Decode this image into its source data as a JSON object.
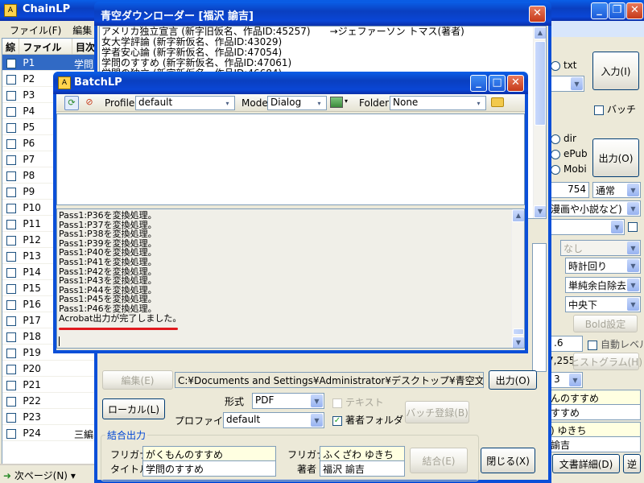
{
  "chainlp": {
    "title": "ChainLP",
    "menu": [
      "ファイル(F)",
      "編集(E)"
    ],
    "list_headers": [
      "綜",
      "ファイル",
      "目次"
    ],
    "rows": [
      {
        "label": "P1",
        "toc": "学問"
      },
      {
        "label": "P2",
        "toc": ""
      },
      {
        "label": "P3",
        "toc": ""
      },
      {
        "label": "P4",
        "toc": ""
      },
      {
        "label": "P5",
        "toc": ""
      },
      {
        "label": "P6",
        "toc": ""
      },
      {
        "label": "P7",
        "toc": ""
      },
      {
        "label": "P8",
        "toc": ""
      },
      {
        "label": "P9",
        "toc": ""
      },
      {
        "label": "P10",
        "toc": ""
      },
      {
        "label": "P11",
        "toc": ""
      },
      {
        "label": "P12",
        "toc": ""
      },
      {
        "label": "P13",
        "toc": ""
      },
      {
        "label": "P14",
        "toc": ""
      },
      {
        "label": "P15",
        "toc": ""
      },
      {
        "label": "P16",
        "toc": ""
      },
      {
        "label": "P17",
        "toc": ""
      },
      {
        "label": "P18",
        "toc": ""
      },
      {
        "label": "P19",
        "toc": ""
      },
      {
        "label": "P20",
        "toc": ""
      },
      {
        "label": "P21",
        "toc": ""
      },
      {
        "label": "P22",
        "toc": ""
      },
      {
        "label": "P23",
        "toc": ""
      },
      {
        "label": "P24",
        "toc": "三編"
      }
    ],
    "next_page": "次ページ(N)",
    "right": {
      "txt": "txt",
      "input_btn": "入力(I)",
      "batch": "バッチ",
      "dir": "dir",
      "epub": "ePub",
      "mobi": "Mobi",
      "output_btn": "出力(O)",
      "num": "754",
      "mode": "通常",
      "genre": "漫画や小説など)",
      "none": "なし",
      "rotate": "時計回り",
      "margin": "単純余白除去",
      "center": "中央下",
      "bold": "Bold設定",
      "val16": ".6",
      "auto_level": "自動レベル",
      "val7255": "7,255",
      "histogram": "ヒストグラム(H)",
      "page3": "3",
      "title1": "んのすすめ",
      "title2": "すすめ",
      "author_kana": ") ゆきち",
      "author": "諭吉",
      "doc_detail": "文書詳細(D)",
      "reverse": "逆"
    }
  },
  "aozora": {
    "title": "青空ダウンローダー [福沢 諭吉]",
    "list": [
      "アメリカ独立宣言 (新字旧仮名、作品ID:45257)　　→ジェファーソン トマス(著者)",
      "女大学評論 (新字新仮名、作品ID:43029)",
      "学者安心論 (新字新仮名、作品ID:47054)",
      "学問のすすめ (新字新仮名、作品ID:47061)",
      "学問の独立 (新字新仮名、作品ID:46684)"
    ],
    "edit_btn": "編集(E)",
    "path": "C:¥Documents and Settings¥Administrator¥デスクトップ¥青空文庫",
    "output_btn": "出力(O)",
    "local_btn": "ローカル(L)",
    "format_label": "形式",
    "format": "PDF",
    "text_chk": "テキスト",
    "profile_label": "プロファイル",
    "profile": "default",
    "author_folder": "著者フォルダ",
    "batch_register": "バッチ登録(B)",
    "group_title": "結合出力",
    "kana_label": "フリガナ",
    "kana_value": "がくもんのすすめ",
    "title_label": "タイトル",
    "title_value": "学問のすすめ",
    "akana_label": "フリガナ",
    "akana_value": "ふくざわ ゆきち",
    "author_label": "著者",
    "author_value": "福沢 諭吉",
    "combine_btn": "結合(E)",
    "close_btn": "閉じる(X)"
  },
  "batch": {
    "title": "BatchLP",
    "profile_label": "Profile",
    "profile": "default",
    "mode_label": "Mode",
    "mode": "Dialog",
    "folder_label": "Folder",
    "folder": "None",
    "log": [
      "Pass1:P36を変換処理。",
      "Pass1:P37を変換処理。",
      "Pass1:P38を変換処理。",
      "Pass1:P39を変換処理。",
      "Pass1:P40を変換処理。",
      "Pass1:P41を変換処理。",
      "Pass1:P42を変換処理。",
      "Pass1:P43を変換処理。",
      "Pass1:P44を変換処理。",
      "Pass1:P45を変換処理。",
      "Pass1:P46を変換処理。"
    ],
    "done": "Acrobat出力が完了しました。"
  },
  "colors": {
    "accent": "#0a46d6",
    "highlight": "#316ac5",
    "underline": "#e0191e"
  }
}
